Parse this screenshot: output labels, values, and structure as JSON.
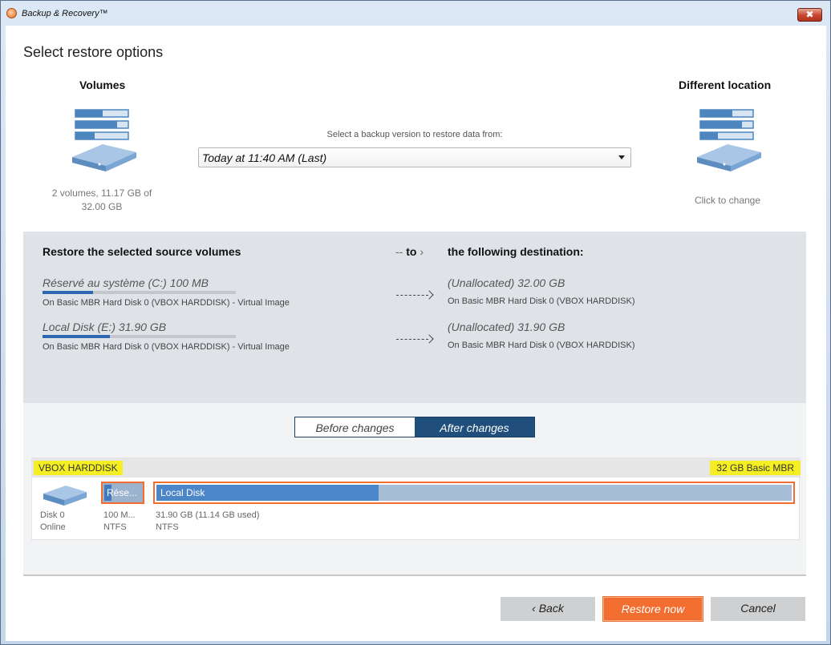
{
  "window": {
    "title": "Backup & Recovery™",
    "close_label": "✖"
  },
  "page": {
    "title": "Select restore options"
  },
  "source": {
    "heading": "Volumes",
    "summary_line1": "2 volumes, 11.17 GB of",
    "summary_line2": "32.00 GB",
    "icon": "server-icon"
  },
  "destination": {
    "heading": "Different location",
    "change_label": "Click to change",
    "icon": "server-icon"
  },
  "version": {
    "label": "Select a backup version to restore data from:",
    "selected": "Today at 11:40 AM (Last)"
  },
  "restore_panel": {
    "source_heading": "Restore the selected source volumes",
    "to_prefix": "--",
    "to_label": "to",
    "dest_heading": "the following destination:",
    "items": [
      {
        "source_name": "Réservé au système (C:) 100 MB",
        "source_usage": 0.26,
        "source_location": "On Basic MBR Hard Disk 0 (VBOX HARDDISK) - Virtual Image",
        "dest_name": "(Unallocated) 32.00 GB",
        "dest_location": "On Basic MBR Hard Disk 0 (VBOX HARDDISK)"
      },
      {
        "source_name": "Local Disk (E:) 31.90 GB",
        "source_usage": 0.35,
        "source_location": "On Basic MBR Hard Disk 0 (VBOX HARDDISK) - Virtual Image",
        "dest_name": "(Unallocated) 31.90 GB",
        "dest_location": "On Basic MBR Hard Disk 0 (VBOX HARDDISK)"
      }
    ]
  },
  "view_toggle": {
    "before_label": "Before changes",
    "after_label": "After changes",
    "active": "after"
  },
  "disk": {
    "name": "VBOX HARDDISK",
    "type": "32 GB Basic MBR",
    "label_line1": "Disk 0",
    "label_line2": "Online",
    "partitions": [
      {
        "label": "Rése...",
        "size": "100 M...",
        "fs": "NTFS",
        "used_fraction": 0.2
      },
      {
        "label": "Local Disk",
        "size": "31.90 GB (11.14 GB used)",
        "fs": "NTFS",
        "used_fraction": 0.35
      }
    ]
  },
  "buttons": {
    "back": "‹ Back",
    "restore": "Restore now",
    "cancel": "Cancel"
  },
  "colors": {
    "accent": "#f26d2f",
    "highlight": "#f4ee22",
    "toggle_active": "#1f4f7a",
    "usage_bar": "#2e67b1"
  }
}
